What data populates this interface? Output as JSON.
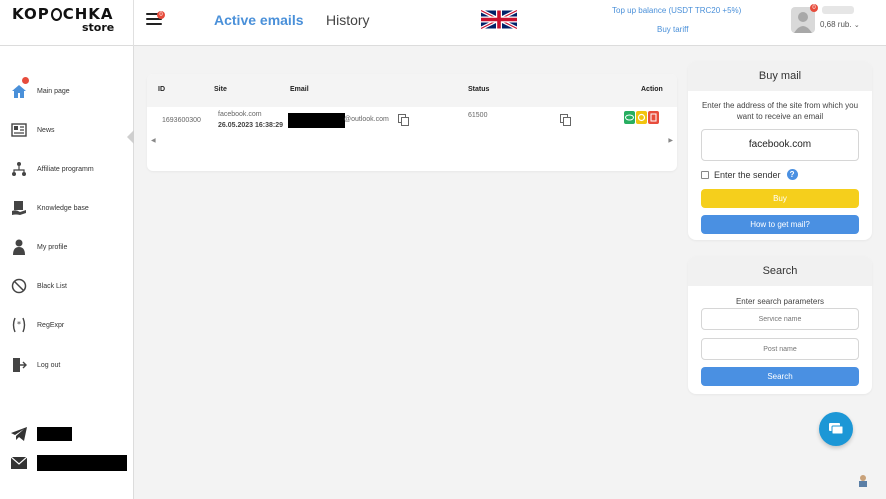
{
  "logo": {
    "main_a": "KOP",
    "main_b": "CHKA",
    "sub": "store"
  },
  "header": {
    "menu_badge": "0",
    "tab_active": "Active emails",
    "tab_history": "History",
    "topup": "Top up balance (USDT TRC20 +5%)",
    "buy_tariff": "Buy tariff",
    "avatar_badge": "0",
    "balance": "0,68 rub."
  },
  "sidebar": {
    "items": [
      {
        "label": "Main page",
        "icon": "home-icon"
      },
      {
        "label": "News",
        "icon": "news-icon"
      },
      {
        "label": "Affiliate programm",
        "icon": "affiliate-icon"
      },
      {
        "label": "Knowledge base",
        "icon": "knowledge-icon"
      },
      {
        "label": "My profile",
        "icon": "user-icon"
      },
      {
        "label": "Black List",
        "icon": "blocked-icon"
      },
      {
        "label": "RegExpr",
        "icon": "regex-icon"
      },
      {
        "label": "Log out",
        "icon": "logout-icon"
      }
    ]
  },
  "table": {
    "headers": {
      "id": "ID",
      "site": "Site",
      "email": "Email",
      "status": "Status",
      "action": "Action"
    },
    "rows": [
      {
        "id": "1693600300",
        "site": "facebook.com",
        "date": "26.05.2023 16:38:29",
        "email_domain": "@outlook.com",
        "status": "61500"
      }
    ]
  },
  "buy_mail": {
    "title": "Buy mail",
    "hint": "Enter the address of the site from which you want to receive an email",
    "site_value": "facebook.com",
    "sender_label": "Enter the sender",
    "buy_label": "Buy",
    "how_label": "How to get mail?"
  },
  "search": {
    "title": "Search",
    "hint": "Enter search parameters",
    "service_placeholder": "Service name",
    "post_placeholder": "Post name",
    "search_label": "Search"
  },
  "colors": {
    "accent": "#4a90d9",
    "buy": "#f5cf1c",
    "blue_btn": "#4a90e2",
    "badge": "#e74c3c"
  }
}
